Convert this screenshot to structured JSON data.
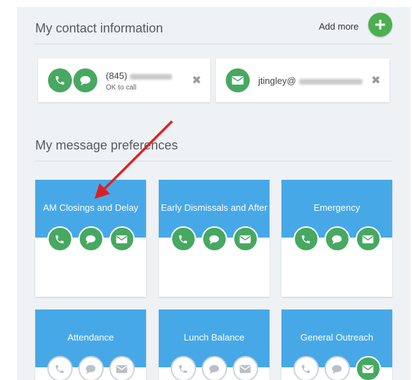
{
  "contact_section": {
    "title": "My contact information",
    "add_more_label": "Add more",
    "phone": {
      "number": "(845)",
      "note": "OK to call"
    },
    "email": {
      "address": "jtingley@"
    }
  },
  "preferences_section": {
    "title": "My message preferences",
    "cards": [
      {
        "title": "AM Closings and Delay",
        "call": true,
        "text": true,
        "email": true
      },
      {
        "title": "Early Dismissals and After",
        "call": true,
        "text": true,
        "email": true
      },
      {
        "title": "Emergency",
        "call": true,
        "text": true,
        "email": true
      },
      {
        "title": "Attendance",
        "call": false,
        "text": false,
        "email": false
      },
      {
        "title": "Lunch Balance",
        "call": false,
        "text": false,
        "email": false
      },
      {
        "title": "General Outreach",
        "call": false,
        "text": false,
        "email": true
      }
    ]
  },
  "colors": {
    "accent_green": "#47a861",
    "card_blue": "#47a8e8",
    "arrow_red": "#e02020"
  },
  "icons": {
    "add": "plus-icon",
    "call": "phone-icon",
    "text": "chat-bubble-icon",
    "email": "envelope-icon",
    "remove": "close-icon"
  }
}
